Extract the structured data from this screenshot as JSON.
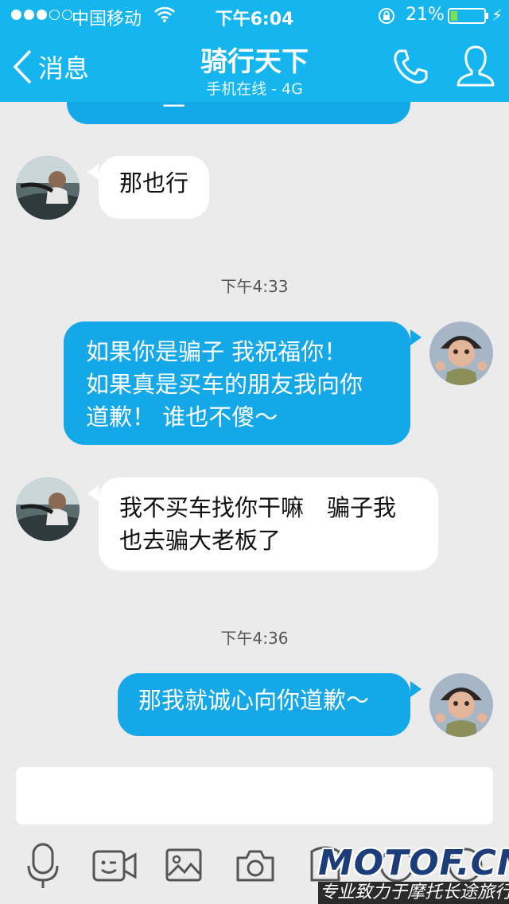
{
  "status_bar": {
    "carrier": "中国移动",
    "time": "下午6:04",
    "battery_percent": "21%",
    "battery_level": 0.21
  },
  "header": {
    "back_label": "消息",
    "title": "骑行天下",
    "subtitle": "手机在线 - 4G"
  },
  "chat": {
    "truncated_top": "一",
    "messages": [
      {
        "side": "in",
        "text": "那也行"
      },
      {
        "timestamp": "下午4:33"
      },
      {
        "side": "out",
        "lines": [
          "如果你是骗子 我祝福你！",
          "如果真是买车的朋友我向你",
          "道歉！ 谁也不傻～"
        ]
      },
      {
        "side": "in",
        "lines": [
          "我不买车找你干嘛　骗子我",
          "也去骗大老板了"
        ]
      },
      {
        "timestamp": "下午4:36"
      },
      {
        "side": "out",
        "text": "那我就诚心向你道歉～"
      }
    ]
  },
  "input": {
    "value": ""
  },
  "toolbar": {
    "icons": [
      "microphone-icon",
      "video-icon",
      "image-icon",
      "camera-icon",
      "file-icon",
      "emoji-icon",
      "more-icon"
    ]
  },
  "watermark": {
    "logo": "MOTOF.CN",
    "tagline": "专业致力于摩托长途旅行"
  },
  "colors": {
    "header_bg": "#15b6ef",
    "outgoing_bubble": "#14a8e8",
    "incoming_bubble": "#ffffff",
    "chat_bg": "#ebebeb"
  }
}
